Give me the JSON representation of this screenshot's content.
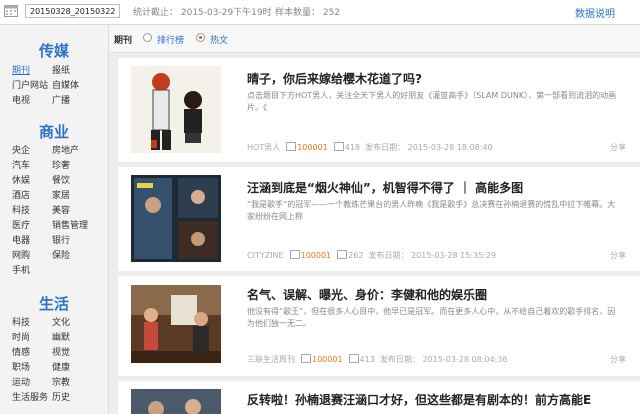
{
  "topbar": {
    "date_value": "20150328_20150322",
    "deadline": "统计截止：  2015-03-29下午19时",
    "sample": "样本数量：  252",
    "help_link": "数据说明"
  },
  "sidebar": {
    "sections": [
      {
        "title": "传媒",
        "items": [
          "期刊",
          "报纸",
          "门户网站",
          "自媒体",
          "电视",
          "广播"
        ]
      },
      {
        "title": "商业",
        "items": [
          "央企",
          "房地产",
          "汽车",
          "珍奢",
          "休娱",
          "餐饮",
          "酒店",
          "家居",
          "科技",
          "美容",
          "医疗",
          "销售管理",
          "电器",
          "银行",
          "网购",
          "保险",
          "手机"
        ]
      },
      {
        "title": "生活",
        "items": [
          "科技",
          "文化",
          "时尚",
          "幽默",
          "情感",
          "视觉",
          "职场",
          "健康",
          "运动",
          "宗教",
          "生活服务",
          "历史"
        ]
      }
    ]
  },
  "filter": {
    "label": "期刊",
    "options": [
      "排行榜",
      "热文"
    ],
    "selected": "热文"
  },
  "cards": [
    {
      "title": "晴子，你后来嫁给樱木花道了吗?",
      "desc": "点击题目下方HOT男人，关注全天下男人的好朋友《灌篮高手》（SLAM DUNK），第一部看到流泪的动画片。《",
      "source": "HOT男人",
      "reads": "100001",
      "likes": "418",
      "date": "发布日期：  2015-03-28 18:08:40",
      "share": "分享"
    },
    {
      "title": "汪涵到底是“烟火神仙”，机智得不得了 ｜ 高能多图",
      "desc": "“我是歌手”的冠军——一个教练芒果台的男人昨晚《我是歌手》总决赛在孙楠退赛的慌乱中拉下帷幕。大家纷纷在网上称",
      "source": "CITYZINE",
      "reads": "100001",
      "likes": "262",
      "date": "发布日期：  2015-03-28 15:35:29",
      "share": "分享"
    },
    {
      "title": "名气、误解、曝光、身价：李健和他的娱乐圈",
      "desc": "他没有得“歌王”，但在很多人心目中，他早已是冠军。而在更多人心中，从不给自己着欢的歌手排名，因为他们独一无二。",
      "source": "三联生活周刊",
      "reads": "100001",
      "likes": "413",
      "date": "发布日期：  2015-03-28 08:04:36",
      "share": "分享"
    },
    {
      "title": "反转啦！孙楠退赛汪涵口才好，但这些都是有剧本的！前方高能E",
      "desc": "",
      "source": "",
      "reads": "",
      "likes": "",
      "date": "",
      "share": ""
    }
  ],
  "colors": {
    "accent": "#2a72c8",
    "highlight": "#e07a18",
    "radio_on": "#e05a1c"
  }
}
